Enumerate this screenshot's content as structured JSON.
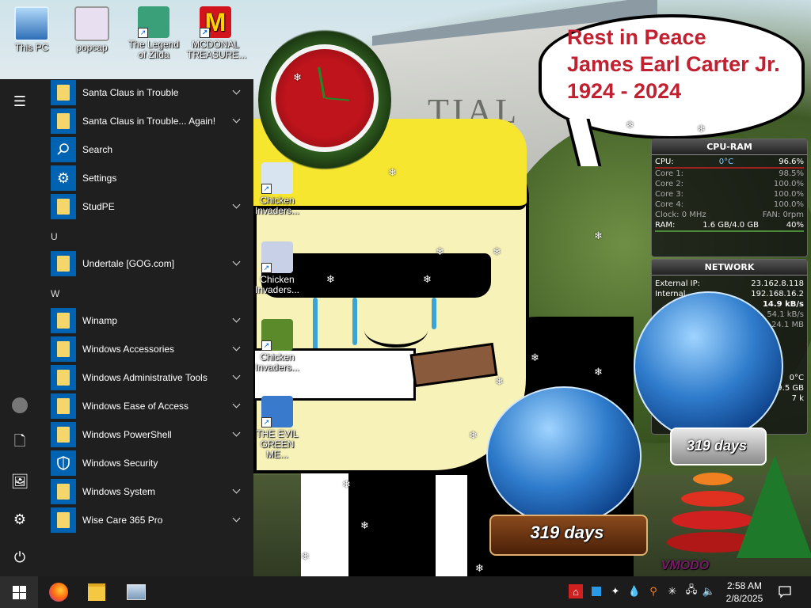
{
  "desktop": {
    "icons": [
      {
        "label": "This PC"
      },
      {
        "label": "popcap"
      },
      {
        "label": "The Legend of Zilda"
      },
      {
        "label": "MCDONAL TREASURE..."
      },
      {
        "label": "Chicken Invaders..."
      },
      {
        "label": "Chicken Invaders..."
      },
      {
        "label": "Chicken Invaders..."
      },
      {
        "label": "THE EVIL GREEN ME..."
      }
    ],
    "bubble": {
      "line1": "Rest in Peace",
      "line2": "James Earl Carter Jr.",
      "line3": "1924 - 2024"
    },
    "building_sign": "TIAL",
    "globe_large_days": "319 days",
    "globe_small_days": "319 days",
    "watermark": "VMODO"
  },
  "cpu_gadget": {
    "title": "CPU-RAM",
    "cpu_label": "CPU:",
    "cpu_temp": "0°C",
    "cpu_percent": "96.6%",
    "cores": [
      {
        "label": "Core 1:",
        "value": "98.5%"
      },
      {
        "label": "Core 2:",
        "value": "100.0%"
      },
      {
        "label": "Core 3:",
        "value": "100.0%"
      },
      {
        "label": "Core 4:",
        "value": "100.0%"
      }
    ],
    "clock": "Clock: 0 MHz",
    "fan": "FAN: 0rpm",
    "ram_label": "RAM:",
    "ram_value": "1.6 GB/4.0 GB",
    "ram_percent": "40%"
  },
  "net_gadget": {
    "title": "NETWORK",
    "external_label": "External IP:",
    "external_ip": "23.162.8.118",
    "internal_label": "Internal",
    "internal_ip": "192.168.16.2",
    "row3": "14.9 kB/s",
    "row4": "54.1 kB/s",
    "row5": "24.1 MB",
    "temp": "0°C",
    "disk": "9.5 GB",
    "misc": "7 k"
  },
  "startmenu": {
    "rail": {
      "menu": "☰",
      "user": "●",
      "documents": "🗋",
      "pictures": "🖼",
      "settings": "⚙",
      "power": "⏻"
    },
    "items": [
      {
        "label": "Santa Claus in Trouble"
      },
      {
        "label": "Santa Claus in Trouble... Again!"
      },
      {
        "label": "Search"
      },
      {
        "label": "Settings"
      },
      {
        "label": "StudPE"
      },
      {
        "label": "Undertale [GOG.com]"
      },
      {
        "label": "Winamp"
      },
      {
        "label": "Windows Accessories"
      },
      {
        "label": "Windows Administrative Tools"
      },
      {
        "label": "Windows Ease of Access"
      },
      {
        "label": "Windows PowerShell"
      },
      {
        "label": "Windows Security"
      },
      {
        "label": "Windows System"
      },
      {
        "label": "Wise Care 365 Pro"
      }
    ],
    "letters": {
      "u": "U",
      "w": "W"
    }
  },
  "taskbar": {
    "time": "2:58 AM",
    "date": "2/8/2025",
    "apps": [
      "firefox-icon",
      "file-explorer-icon",
      "control-panel-icon"
    ]
  }
}
